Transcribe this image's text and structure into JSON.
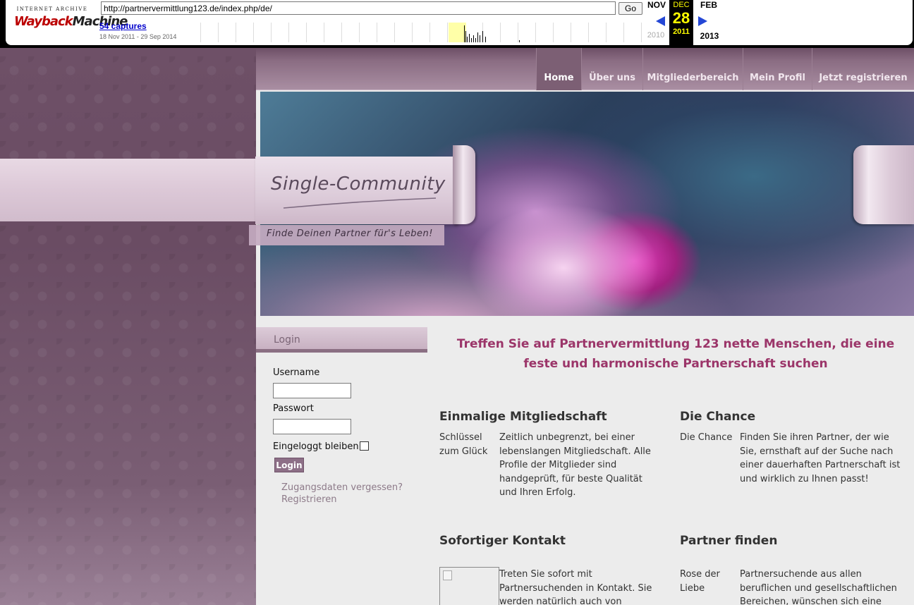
{
  "wayback": {
    "logo_top": "INTERNET ARCHIVE",
    "logo_main_a": "Wayback",
    "logo_main_b": "Machine",
    "url": "http://partnervermittlung123.de/index.php/de/",
    "go_label": "Go",
    "captures": "54 captures",
    "range": "18 Nov 2011 - 29 Sep 2014",
    "prev_month": "NOV",
    "current_month": "DEC",
    "current_day": "28",
    "current_year": "2011",
    "next_month": "FEB",
    "prev_year": "2010",
    "next_year": "2013",
    "accent": "#2447d6",
    "highlight": "#ffff00"
  },
  "nav": {
    "items": [
      {
        "label": "Home",
        "active": true
      },
      {
        "label": "Über uns",
        "active": false
      },
      {
        "label": "Mitgliederbereich",
        "active": false
      },
      {
        "label": "Mein Profil",
        "active": false
      },
      {
        "label": "Jetzt registrieren",
        "active": false
      }
    ]
  },
  "brand": {
    "title": "Single-Community",
    "tagline": "Finde Deinen Partner für's Leben!"
  },
  "login": {
    "header": "Login",
    "username_label": "Username",
    "username_value": "",
    "password_label": "Passwort",
    "password_value": "",
    "remember_label": "Eingeloggt bleiben",
    "button": "Login",
    "forgot_link": "Zugangsdaten vergessen?",
    "register_link": "Registrieren"
  },
  "main": {
    "headline_line1": "Treffen Sie auf Partnervermittlung 123 nette Menschen, die eine",
    "headline_line2": "feste und harmonische Partnerschaft suchen",
    "sections": [
      {
        "title": "Einmalige Mitgliedschaft",
        "left": "Schlüssel zum Glück",
        "body": "Zeitlich unbegrenzt, bei einer lebenslangen Mitgliedschaft. Alle Profile der Mitglieder sind handgeprüft, für beste Qualität und Ihren Erfolg."
      },
      {
        "title": "Die Chance",
        "left": "Die Chance",
        "body": "Finden Sie ihren Partner, der wie Sie, ernsthaft auf der Suche nach einer dauerhaften Partnerschaft ist und wirklich zu Ihnen passt!"
      },
      {
        "title": "Sofortiger Kontakt",
        "left": "",
        "body": "Treten Sie sofort mit Partnersuchenden in Kontakt. Sie werden natürlich auch von"
      },
      {
        "title": "Partner finden",
        "left": "Rose der Liebe",
        "body": "Partnersuchende aus allen beruflichen und gesellschaftlichen Bereichen, wünschen sich eine"
      }
    ],
    "accent_color": "#9b3569"
  }
}
